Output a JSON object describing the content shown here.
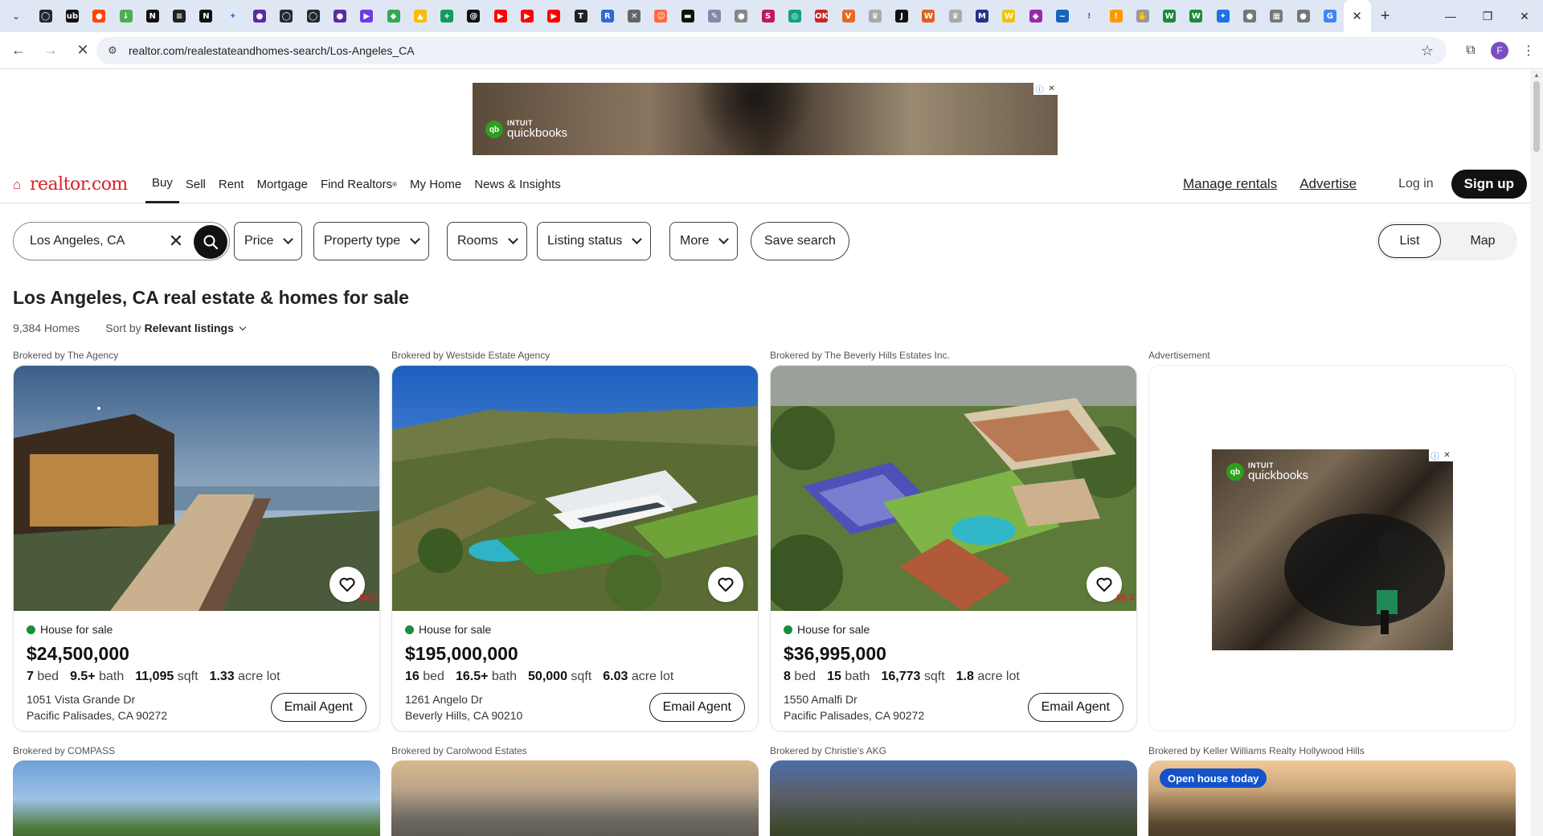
{
  "browser": {
    "url": "realtor.com/realestateandhomes-search/Los-Angeles_CA",
    "tab_favicons": [
      {
        "icon": "github-icon",
        "bg": "#24292f",
        "glyph": "◯"
      },
      {
        "icon": "ub-icon",
        "bg": "#111111",
        "glyph": "ub"
      },
      {
        "icon": "reddit-icon",
        "bg": "#ff4500",
        "glyph": "●"
      },
      {
        "icon": "download-icon",
        "bg": "#4caf50",
        "glyph": "↓"
      },
      {
        "icon": "n-icon",
        "bg": "#111111",
        "glyph": "N"
      },
      {
        "icon": "layers-icon",
        "bg": "#222222",
        "glyph": "≡"
      },
      {
        "icon": "n-icon",
        "bg": "#111111",
        "glyph": "N"
      },
      {
        "icon": "sparkle-icon",
        "bg": "#dfe7f5",
        "glyph": "✦"
      },
      {
        "icon": "purple-icon",
        "bg": "#5b2ca0",
        "glyph": "●"
      },
      {
        "icon": "github-icon",
        "bg": "#24292f",
        "glyph": "◯"
      },
      {
        "icon": "github-icon",
        "bg": "#24292f",
        "glyph": "◯"
      },
      {
        "icon": "purple-icon",
        "bg": "#5b2ca0",
        "glyph": "●"
      },
      {
        "icon": "video-icon",
        "bg": "#6a3de8",
        "glyph": "▶"
      },
      {
        "icon": "maps-icon",
        "bg": "#34a853",
        "glyph": "◆"
      },
      {
        "icon": "drive-icon",
        "bg": "#fbbc04",
        "glyph": "▲"
      },
      {
        "icon": "plus-icon",
        "bg": "#0f9d58",
        "glyph": "+"
      },
      {
        "icon": "threads-icon",
        "bg": "#111111",
        "glyph": "@"
      },
      {
        "icon": "youtube-icon",
        "bg": "#ff0000",
        "glyph": "▶"
      },
      {
        "icon": "youtube-icon",
        "bg": "#ff0000",
        "glyph": "▶"
      },
      {
        "icon": "youtube-icon",
        "bg": "#ff0000",
        "glyph": "▶"
      },
      {
        "icon": "news-icon",
        "bg": "#222222",
        "glyph": "T"
      },
      {
        "icon": "bookmark-icon",
        "bg": "#3367d6",
        "glyph": "R"
      },
      {
        "icon": "tools-icon",
        "bg": "#666666",
        "glyph": "✕"
      },
      {
        "icon": "face-icon",
        "bg": "#ff6a3d",
        "glyph": "☺"
      },
      {
        "icon": "abc-icon",
        "bg": "#111111",
        "glyph": "▬"
      },
      {
        "icon": "feather-icon",
        "bg": "#8888aa",
        "glyph": "✎"
      },
      {
        "icon": "globe-icon",
        "bg": "#888888",
        "glyph": "●"
      },
      {
        "icon": "s-icon",
        "bg": "#c2185b",
        "glyph": "S"
      },
      {
        "icon": "circle-icon",
        "bg": "#10a37f",
        "glyph": "◎"
      },
      {
        "icon": "ok-icon",
        "bg": "#c62828",
        "glyph": "OK"
      },
      {
        "icon": "v-icon",
        "bg": "#e66a1f",
        "glyph": "V"
      },
      {
        "icon": "crown-icon",
        "bg": "#aaaaaa",
        "glyph": "♛"
      },
      {
        "icon": "j-icon",
        "bg": "#111111",
        "glyph": "J"
      },
      {
        "icon": "fox-icon",
        "bg": "#e06020",
        "glyph": "W"
      },
      {
        "icon": "crown-icon",
        "bg": "#aaaaaa",
        "glyph": "♛"
      },
      {
        "icon": "m-icon",
        "bg": "#223388",
        "glyph": "M"
      },
      {
        "icon": "w-icon",
        "bg": "#f4c20d",
        "glyph": "W"
      },
      {
        "icon": "gemini-icon",
        "bg": "#9c27b0",
        "glyph": "◆"
      },
      {
        "icon": "wave-icon",
        "bg": "#1565c0",
        "glyph": "~"
      },
      {
        "icon": "exclaim-icon",
        "bg": "#dfe7f5",
        "glyph": "!"
      },
      {
        "icon": "exclaim-icon",
        "bg": "#ff9800",
        "glyph": "!"
      },
      {
        "icon": "hand-icon",
        "bg": "#999999",
        "glyph": "✋"
      },
      {
        "icon": "w-icon",
        "bg": "#1b8a3a",
        "glyph": "W"
      },
      {
        "icon": "w-icon",
        "bg": "#1b8a3a",
        "glyph": "W"
      },
      {
        "icon": "sparkle-icon",
        "bg": "#1a73e8",
        "glyph": "✦"
      },
      {
        "icon": "globe-icon",
        "bg": "#777777",
        "glyph": "●"
      },
      {
        "icon": "image-icon",
        "bg": "#777777",
        "glyph": "▦"
      },
      {
        "icon": "globe-icon",
        "bg": "#777777",
        "glyph": "●"
      },
      {
        "icon": "google-icon",
        "bg": "#4285f4",
        "glyph": "G"
      }
    ]
  },
  "top_ad": {
    "brand_small": "INTUIT",
    "brand": "quickbooks"
  },
  "header": {
    "logo": "realtor.com",
    "nav": [
      "Buy",
      "Sell",
      "Rent",
      "Mortgage",
      "Find Realtors",
      "My Home",
      "News & Insights"
    ],
    "find_realtors_mark": "®",
    "manage_rentals": "Manage rentals",
    "advertise": "Advertise",
    "login": "Log in",
    "signup": "Sign up"
  },
  "search": {
    "value": "Los Angeles, CA",
    "filters": [
      "Price",
      "Property type",
      "Rooms",
      "Listing status",
      "More"
    ],
    "save_search": "Save search",
    "view_list": "List",
    "view_map": "Map"
  },
  "results": {
    "title": "Los Angeles, CA real estate & homes for sale",
    "count": "9,384 Homes",
    "sort_label": "Sort by",
    "sort_value": "Relevant listings"
  },
  "listings": [
    {
      "broker": "Brokered by The Agency",
      "status": "House for sale",
      "price": "$24,500,000",
      "beds": "7",
      "baths": "9.5+",
      "sqft": "11,095",
      "lot": "1.33",
      "address1": "1051 Vista Grande Dr",
      "address2": "Pacific Palisades, CA 90272",
      "email": "Email Agent"
    },
    {
      "broker": "Brokered by Westside Estate Agency",
      "status": "House for sale",
      "price": "$195,000,000",
      "beds": "16",
      "baths": "16.5+",
      "sqft": "50,000",
      "lot": "6.03",
      "address1": "1261 Angelo Dr",
      "address2": "Beverly Hills, CA 90210",
      "email": "Email Agent"
    },
    {
      "broker": "Brokered by The Beverly Hills Estates Inc.",
      "status": "House for sale",
      "price": "$36,995,000",
      "beds": "8",
      "baths": "15",
      "sqft": "16,773",
      "lot": "1.8",
      "address1": "1550 Amalfi Dr",
      "address2": "Pacific Palisades, CA 90272",
      "email": "Email Agent"
    }
  ],
  "units": {
    "bed": "bed",
    "bath": "bath",
    "sqft": "sqft",
    "lot": "acre lot"
  },
  "advertisement_label": "Advertisement",
  "row2": [
    {
      "broker": "Brokered by COMPASS"
    },
    {
      "broker": "Brokered by Carolwood Estates"
    },
    {
      "broker": "Brokered by Christie's AKG"
    },
    {
      "broker": "Brokered by Keller Williams Realty Hollywood Hills",
      "badge": "Open house today"
    }
  ],
  "mls_badge": "MLS"
}
